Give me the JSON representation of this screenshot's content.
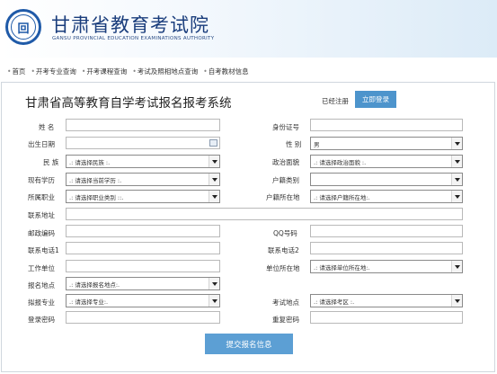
{
  "header": {
    "logo_char": "回",
    "title": "甘肃省教育考试院",
    "subtitle": "GANSU PROVINCIAL EDUCATION EXAMINATIONS AUTHORITY"
  },
  "nav": [
    {
      "label": "首页"
    },
    {
      "label": "开考专业查询"
    },
    {
      "label": "开考课程查询"
    },
    {
      "label": "考试及照相地点查询"
    },
    {
      "label": "自考教材信息"
    }
  ],
  "form": {
    "title": "甘肃省高等教育自学考试报名报考系统",
    "registered_text": "已经注册",
    "login_button": "立即登录",
    "submit_button": "提交报名信息",
    "fields": {
      "name": {
        "label": "姓  名",
        "value": ""
      },
      "id_number": {
        "label": "身份证号",
        "value": ""
      },
      "birth_date": {
        "label": "出生日期",
        "value": ""
      },
      "gender": {
        "label": "性  别",
        "value": "男"
      },
      "ethnicity": {
        "label": "民  族",
        "value": ".: 请选择民族 :."
      },
      "political_status": {
        "label": "政治面貌",
        "value": ".: 请选择政治面貌 :."
      },
      "education": {
        "label": "现有学历",
        "value": ".: 请选择当前学历 :."
      },
      "household_type": {
        "label": "户籍类别",
        "value": ""
      },
      "occupation": {
        "label": "所属职业",
        "value": ".: 请选择职业类别 ::."
      },
      "household_location": {
        "label": "户籍所在地",
        "value": ".: 请选择户籍所在地:."
      },
      "address": {
        "label": "联系地址",
        "value": ""
      },
      "postcode": {
        "label": "邮政编码",
        "value": ""
      },
      "qq": {
        "label": "QQ号码",
        "value": ""
      },
      "phone1": {
        "label": "联系电话1",
        "value": ""
      },
      "phone2": {
        "label": "联系电话2",
        "value": ""
      },
      "work_unit": {
        "label": "工作单位",
        "value": ""
      },
      "unit_location": {
        "label": "单位所在地",
        "value": ".: 请选择单位所在地:."
      },
      "registration_site": {
        "label": "报名地点",
        "value": ".: 请选择报名地点:."
      },
      "major": {
        "label": "拟报专业",
        "value": ".: 请选择专业:."
      },
      "exam_site": {
        "label": "考试地点",
        "value": ".: 请选择考区 :."
      },
      "password": {
        "label": "登录密码",
        "value": ""
      },
      "password_confirm": {
        "label": "重复密码",
        "value": ""
      }
    }
  }
}
